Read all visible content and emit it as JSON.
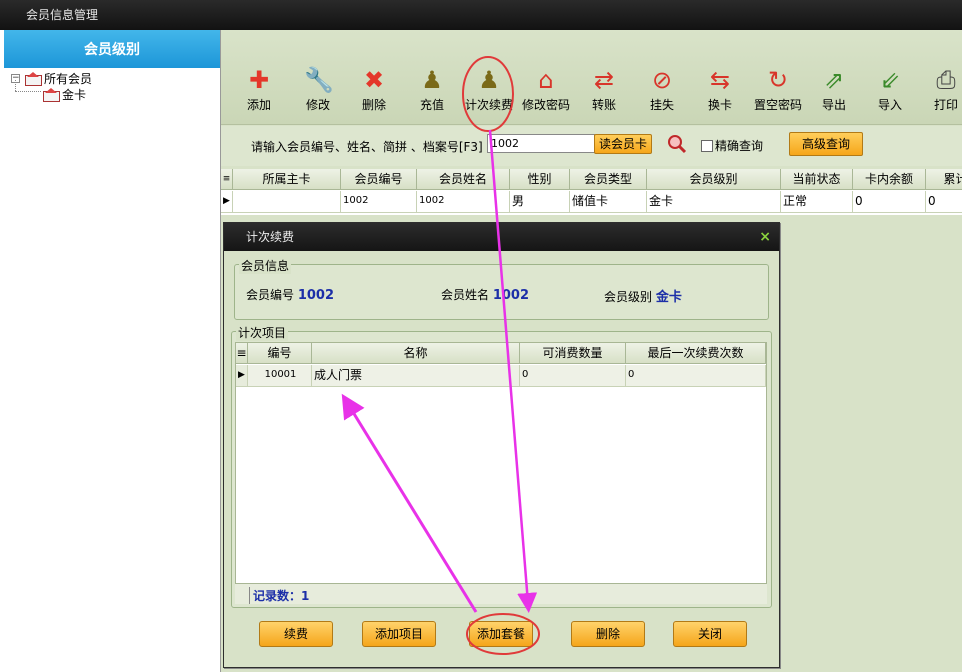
{
  "window": {
    "title": "会员信息管理"
  },
  "sidebar": {
    "header": "会员级别",
    "tree": [
      {
        "label": "所有会员",
        "expander": "−"
      },
      {
        "label": "金卡"
      }
    ]
  },
  "toolbar": {
    "buttons": [
      {
        "label": "添加",
        "icon": "add-icon",
        "glyph": "✚",
        "color": "#e4372a"
      },
      {
        "label": "修改",
        "icon": "wrench-icon",
        "glyph": "🔧",
        "color": "#8a8a8a"
      },
      {
        "label": "删除",
        "icon": "delete-icon",
        "glyph": "✖",
        "color": "#e4372a"
      },
      {
        "label": "充值",
        "icon": "pawn-icon",
        "glyph": "♟",
        "color": "#7a6a18"
      },
      {
        "label": "计次续费",
        "icon": "pawn-icon",
        "glyph": "♟",
        "color": "#7a6a18"
      },
      {
        "label": "修改密码",
        "icon": "house-icon",
        "glyph": "⌂",
        "color": "#d8352a"
      },
      {
        "label": "转账",
        "icon": "transfer-icon",
        "glyph": "⇄",
        "color": "#d8352a"
      },
      {
        "label": "挂失",
        "icon": "forbidden-icon",
        "glyph": "⊘",
        "color": "#d8352a"
      },
      {
        "label": "换卡",
        "icon": "swap-icon",
        "glyph": "⇆",
        "color": "#d8352a"
      },
      {
        "label": "置空密码",
        "icon": "reset-icon",
        "glyph": "↻",
        "color": "#d8352a"
      },
      {
        "label": "导出",
        "icon": "export-icon",
        "glyph": "⇗",
        "color": "#3a8a2a"
      },
      {
        "label": "导入",
        "icon": "import-icon",
        "glyph": "⇙",
        "color": "#3a8a2a"
      },
      {
        "label": "打印",
        "icon": "printer-icon",
        "glyph": "⎙",
        "color": "#444"
      }
    ]
  },
  "search": {
    "label": "请输入会员编号、姓名、简拼 、档案号[F3]",
    "value": "1002",
    "read_card_label": "读会员卡",
    "exact_label": "精确查询",
    "advanced_label": "高级查询"
  },
  "member_grid": {
    "columns": [
      "所属主卡",
      "会员编号",
      "会员姓名",
      "性别",
      "会员类型",
      "会员级别",
      "当前状态",
      "卡内余额",
      "累计"
    ],
    "rows": [
      [
        "",
        "1002",
        "1002",
        "男",
        "储值卡",
        "金卡",
        "正常",
        "0",
        "0"
      ]
    ]
  },
  "dialog": {
    "title": "计次续费",
    "close": "×",
    "member_info": {
      "legend": "会员信息",
      "number_label": "会员编号",
      "number_value": "1002",
      "name_label": "会员姓名",
      "name_value": "1002",
      "level_label": "会员级别",
      "level_value": "金卡"
    },
    "items": {
      "legend": "计次项目",
      "columns": [
        "编号",
        "名称",
        "可消费数量",
        "最后一次续费次数"
      ],
      "rows": [
        [
          "10001",
          "成人门票",
          "0",
          "0"
        ]
      ],
      "record_count": "记录数：1"
    },
    "buttons": {
      "renew": "续费",
      "add_item": "添加项目",
      "add_package": "添加套餐",
      "delete": "删除",
      "close": "关闭"
    }
  },
  "colors": {
    "annotation": "#e832e8",
    "highlight_circle": "#e03a3a",
    "accent_blue": "#1c2fa8"
  }
}
